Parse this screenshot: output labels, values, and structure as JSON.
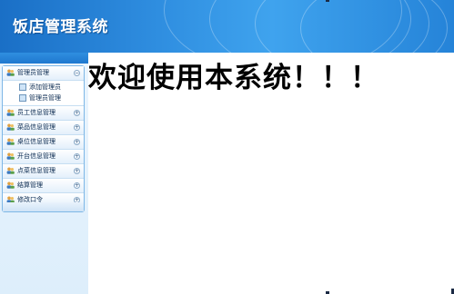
{
  "app": {
    "title": "饭店管理系统"
  },
  "sidebar": {
    "groups": [
      {
        "label": "管理员管理",
        "expanded": true,
        "toggle": "−",
        "children": [
          {
            "label": "添加管理员"
          },
          {
            "label": "管理员管理"
          }
        ]
      },
      {
        "label": "员工信息管理",
        "toggle": "+"
      },
      {
        "label": "菜品信息管理",
        "toggle": "+"
      },
      {
        "label": "桌位信息管理",
        "toggle": "+"
      },
      {
        "label": "开台信息管理",
        "toggle": "+"
      },
      {
        "label": "点菜信息管理",
        "toggle": "+"
      },
      {
        "label": "结算管理",
        "toggle": "+"
      },
      {
        "label": "修改口令",
        "toggle": "+"
      }
    ]
  },
  "main": {
    "welcome_text": "欢迎使用本系统！！！"
  },
  "colors": {
    "header_blue": "#2583d8",
    "sidebar_bg": "#eaf4fd",
    "menu_border": "#7eb7e6"
  }
}
